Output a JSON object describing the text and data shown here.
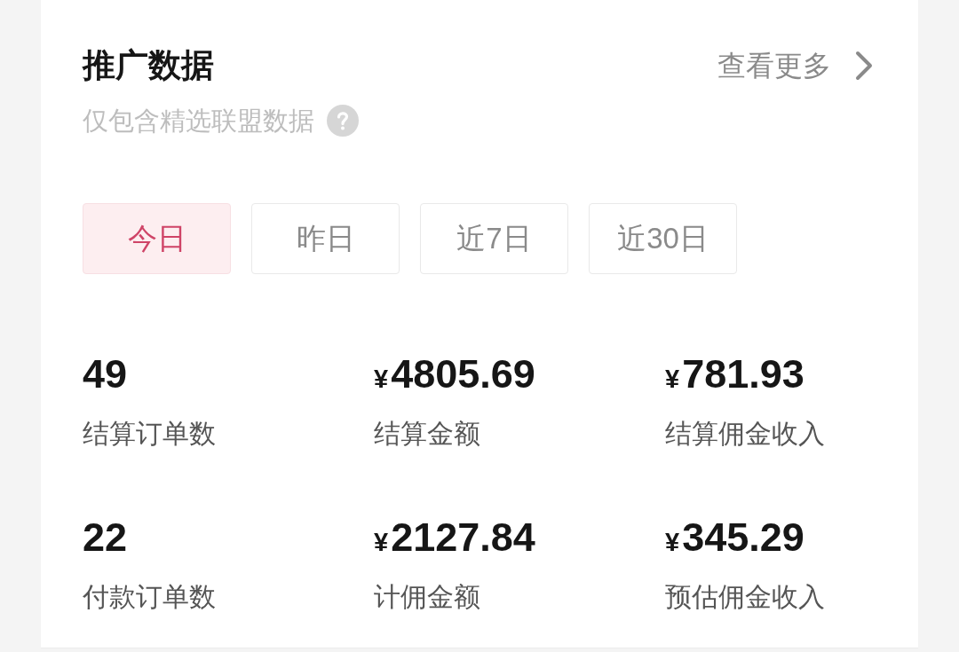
{
  "header": {
    "title": "推广数据",
    "more_link": "查看更多",
    "subtitle": "仅包含精选联盟数据"
  },
  "tabs": [
    {
      "label": "今日",
      "selected": true
    },
    {
      "label": "昨日",
      "selected": false
    },
    {
      "label": "近7日",
      "selected": false
    },
    {
      "label": "近30日",
      "selected": false
    }
  ],
  "metrics": [
    {
      "value": "49",
      "label": "结算订单数"
    },
    {
      "currency": "¥",
      "value": "4805.69",
      "label": "结算金额"
    },
    {
      "currency": "¥",
      "value": "781.93",
      "label": "结算佣金收入"
    },
    {
      "value": "22",
      "label": "付款订单数"
    },
    {
      "currency": "¥",
      "value": "2127.84",
      "label": "计佣金额"
    },
    {
      "currency": "¥",
      "value": "345.29",
      "label": "预估佣金收入"
    }
  ]
}
